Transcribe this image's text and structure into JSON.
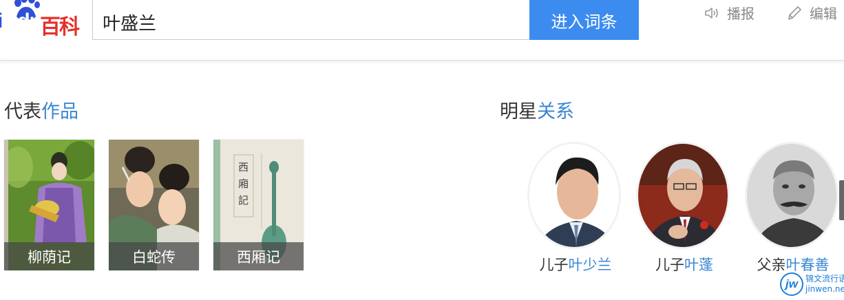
{
  "header": {
    "logo": {
      "du_text": "i",
      "du_text2": "du",
      "baike_text": "百科"
    },
    "search": {
      "value": "叶盛兰"
    },
    "search_button": "进入词条",
    "tools": {
      "play": "播报",
      "edit": "编辑"
    }
  },
  "works": {
    "title_plain": "代表",
    "title_highlight": "作品",
    "items": [
      {
        "label": "柳荫记"
      },
      {
        "label": "白蛇传"
      },
      {
        "label": "西厢记"
      }
    ],
    "book_cover_text": "西廂記"
  },
  "stars": {
    "title_plain": "明星",
    "title_highlight": "关系",
    "items": [
      {
        "relation": "儿子",
        "name": "叶少兰"
      },
      {
        "relation": "儿子",
        "name": "叶蓬"
      },
      {
        "relation": "父亲",
        "name": "叶春善"
      }
    ]
  },
  "watermark": {
    "logo": "jw",
    "line1": "锦文流行语",
    "line2": "jinwen.net"
  },
  "colors": {
    "accent_blue": "#3a86d4",
    "button_blue": "#3c8cf0",
    "baike_red": "#e5312c",
    "du_blue": "#2e4fd8"
  },
  "icons": {
    "play": "speaker-icon",
    "edit": "pencil-icon"
  }
}
